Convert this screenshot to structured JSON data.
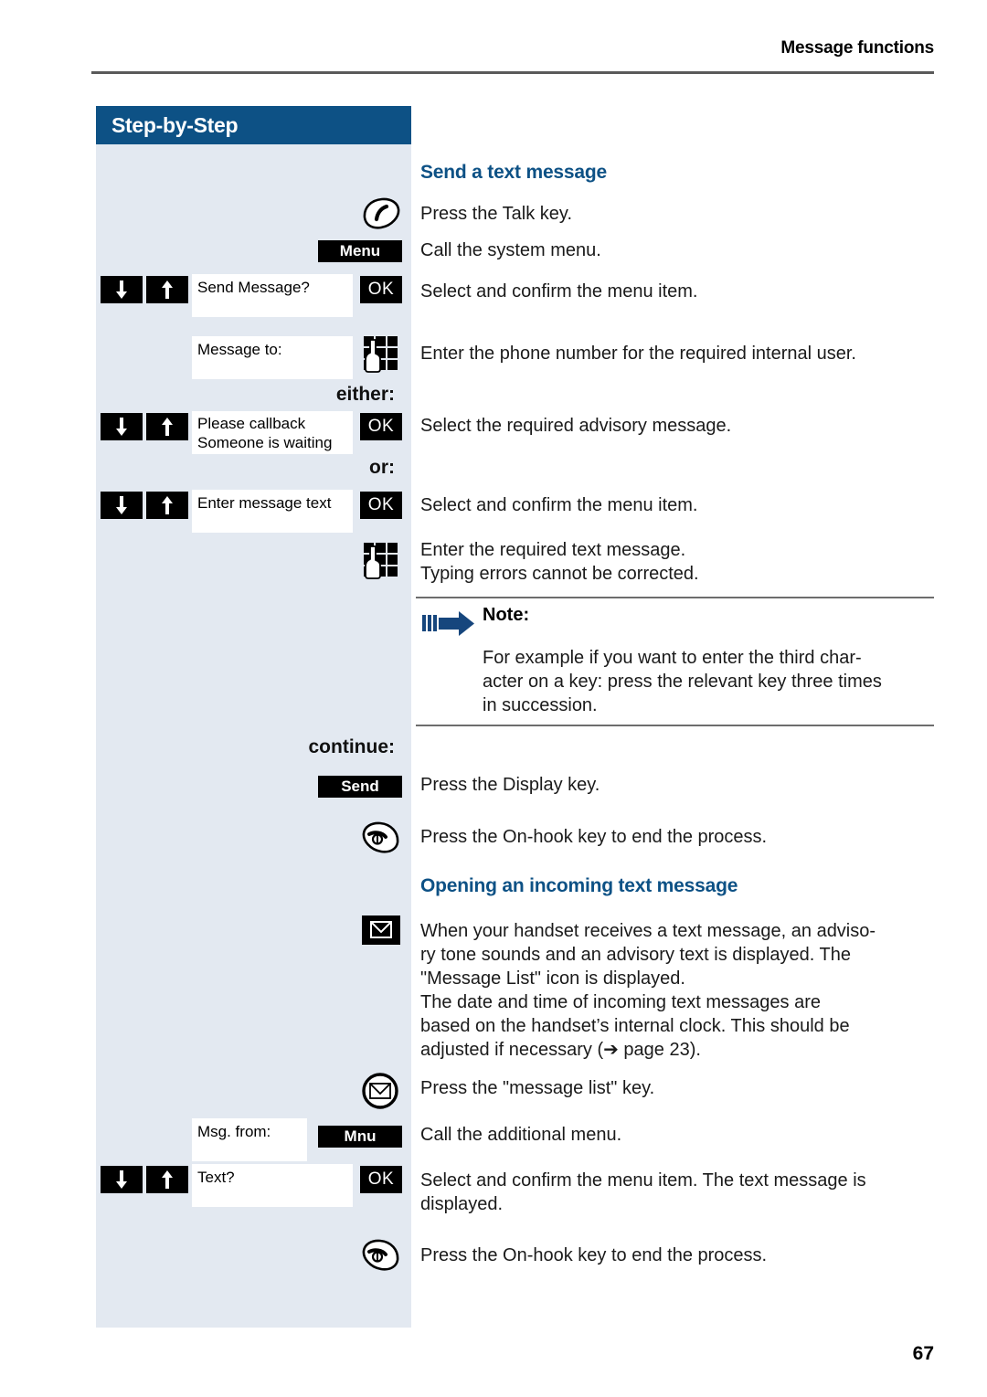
{
  "header": {
    "chapter_title": "Message functions"
  },
  "sidebar": {
    "title": "Step-by-Step",
    "labels": {
      "either": "either:",
      "or": "or:",
      "continue": "continue:"
    },
    "keys": {
      "menu": "Menu",
      "ok": "OK",
      "send": "Send",
      "mnu": "Mnu"
    },
    "displays": {
      "send_message": "Send Message?",
      "message_to": "Message to:",
      "please_callback": "Please callback",
      "someone_waiting": "Someone is waiting",
      "enter_message_text": "Enter message text",
      "msg_from": "Msg. from:",
      "text_q": "Text?"
    },
    "icons": {
      "talk_key": "talk-key-icon",
      "keypad": "keypad-hand-icon",
      "on_hook_key": "on-hook-key-icon",
      "message_indicator": "message-list-indicator-icon",
      "message_list_key": "message-list-key-icon",
      "down_arrow": "down-arrow-key-icon",
      "up_arrow": "up-arrow-key-icon"
    }
  },
  "main": {
    "section1": {
      "heading": "Send a text message",
      "steps": [
        "Press the Talk key.",
        "Call the system menu.",
        "Select and confirm the menu item.",
        "Enter the phone number for the required internal user.",
        "Select the required advisory message.",
        "Select and confirm the menu item."
      ],
      "enter_text_line1": "Enter the required text message.",
      "enter_text_line2": "Typing errors cannot be corrected.",
      "press_display_key": "Press the Display key.",
      "press_onhook_key": "Press the On-hook key to end the process."
    },
    "note": {
      "title": "Note:",
      "line1": "For example  if you want to enter the third char-",
      "line2": "acter on a key: press the relevant key three times",
      "line3": "in succession."
    },
    "section2": {
      "heading": "Opening an incoming text message",
      "para1_line1": "When your handset receives a text message, an adviso-",
      "para1_line2": "ry tone sounds and an advisory text is displayed. The",
      "para1_line3": "\"Message List\" icon is displayed.",
      "para1_line4": "The date and time of incoming text messages are",
      "para1_line5": "based on the handset’s internal clock. This should be",
      "para1_line6": "adjusted if necessary (➔ page 23).",
      "press_message_list": "Press the \"message list\" key.",
      "call_additional_menu": "Call the additional menu.",
      "select_confirm_line1": "Select and confirm the menu item. The text message is",
      "select_confirm_line2": "displayed.",
      "press_onhook_key": "Press the On-hook key to end the process."
    }
  },
  "footer": {
    "page_number": "67"
  },
  "colors": {
    "brand_blue": "#0d5185",
    "sidebar_bg": "#e3e9f1",
    "rule_grey": "#5a5a5a"
  }
}
